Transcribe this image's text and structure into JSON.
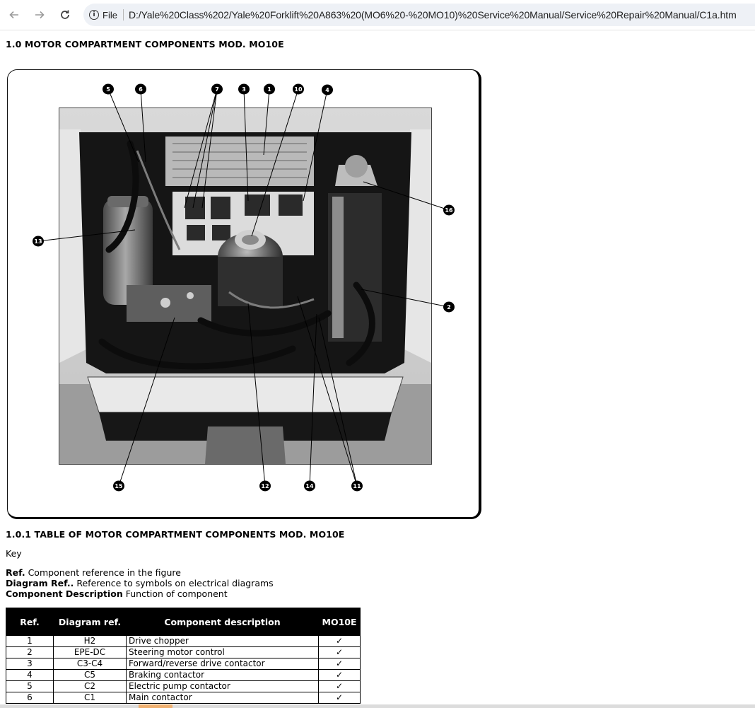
{
  "browser": {
    "back_icon": "arrow-left-icon",
    "forward_icon": "arrow-right-icon",
    "reload_icon": "reload-icon",
    "scheme_label": "File",
    "url": "D:/Yale%20Class%202/Yale%20Forklift%20A863%20(MO6%20-%20MO10)%20Service%20Manual/Service%20Repair%20Manual/C1a.htm"
  },
  "doc": {
    "title": "1.0 MOTOR COMPARTMENT COMPONENTS MOD. MO10E",
    "table_title": "1.0.1 TABLE OF MOTOR COMPARTMENT COMPONENTS MOD. MO10E",
    "key_label": "Key",
    "definitions": [
      {
        "term": "Ref.",
        "text": " Component reference in the figure"
      },
      {
        "term": "Diagram Ref..",
        "text": " Reference to symbols on electrical diagrams"
      },
      {
        "term": "Component Description",
        "text": " Function of component"
      }
    ]
  },
  "figure": {
    "callouts": [
      "5",
      "6",
      "7",
      "3",
      "1",
      "10",
      "4",
      "16",
      "13",
      "2",
      "15",
      "12",
      "14",
      "11"
    ]
  },
  "table": {
    "headers": {
      "ref": "Ref.",
      "diagram": "Diagram ref.",
      "description": "Component description",
      "model": "MO10E"
    },
    "rows": [
      {
        "ref": "1",
        "diagram": "H2",
        "description": "Drive chopper",
        "model": "✓"
      },
      {
        "ref": "2",
        "diagram": "EPE-DC",
        "description": "Steering motor control",
        "model": "✓"
      },
      {
        "ref": "3",
        "diagram": "C3-C4",
        "description": "Forward/reverse drive contactor",
        "model": "✓"
      },
      {
        "ref": "4",
        "diagram": "C5",
        "description": "Braking contactor",
        "model": "✓"
      },
      {
        "ref": "5",
        "diagram": "C2",
        "description": "Electric pump contactor",
        "model": "✓"
      },
      {
        "ref": "6",
        "diagram": "C1",
        "description": "Main contactor",
        "model": "✓"
      }
    ]
  }
}
